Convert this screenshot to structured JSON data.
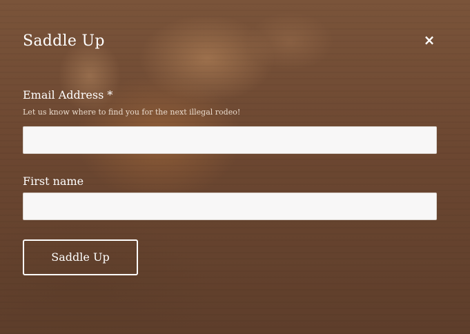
{
  "modal": {
    "title": "Saddle Up",
    "close_symbol": "×",
    "close_icon": "close-icon"
  },
  "form": {
    "email": {
      "label": "Email Address *",
      "hint": "Let us know where to find you for the next illegal rodeo!",
      "value": "",
      "placeholder": ""
    },
    "first_name": {
      "label": "First name",
      "value": "",
      "placeholder": ""
    },
    "submit_label": "Saddle Up"
  },
  "colors": {
    "overlay": "#6e4a33",
    "text": "#ffffff",
    "input_bg": "#f8f7f7"
  }
}
